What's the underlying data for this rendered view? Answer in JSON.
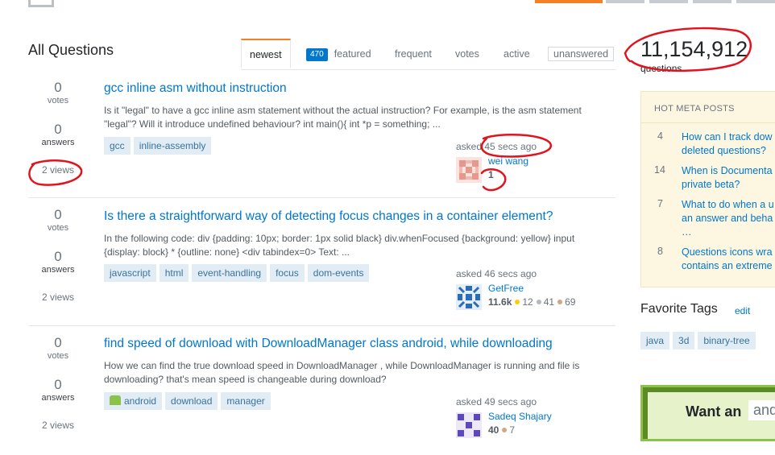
{
  "header": {
    "title": "All Questions"
  },
  "tabs": [
    {
      "label": "newest"
    },
    {
      "label": "featured",
      "badge": "470"
    },
    {
      "label": "frequent"
    },
    {
      "label": "votes"
    },
    {
      "label": "active"
    },
    {
      "label": "unanswered"
    }
  ],
  "questions": [
    {
      "votes": "0",
      "votes_label": "votes",
      "answers": "0",
      "answers_label": "answers",
      "views": "2 views",
      "title": "gcc inline asm without instruction",
      "excerpt": "Is it \"legal\" to have a gcc inline asm statement without the actual instruction? For example, is the asm statement \"legal\"? Will it introduce undefined behaviour? int main(){ int *p = something; ...",
      "tags": [
        "gcc",
        "inline-assembly"
      ],
      "asked": "asked 45 secs ago",
      "user": "wei wang",
      "rep": "1"
    },
    {
      "votes": "0",
      "votes_label": "votes",
      "answers": "0",
      "answers_label": "answers",
      "views": "2 views",
      "title": "Is there a straightforward way of detecting focus changes in a container element?",
      "excerpt": "In the following code: div {padding: 10px; border: 1px solid black} div.whenFocused {background: yellow} input {display: block} * {outline: none} <div tabindex=0> Text: ...",
      "tags": [
        "javascript",
        "html",
        "event-handling",
        "focus",
        "dom-events"
      ],
      "asked": "asked 46 secs ago",
      "user": "GetFree",
      "rep": "11.6k",
      "gold": "12",
      "silver": "41",
      "bronze": "69"
    },
    {
      "votes": "0",
      "votes_label": "votes",
      "answers": "0",
      "answers_label": "answers",
      "views": "2 views",
      "title": "find speed of download with DownloadManager class android, while downloading",
      "excerpt": "How we can find the true download speed in DownloadManager , while DownloadManager is running and file is downloading? that's mean speed is changeable during download?",
      "tags": [
        "android",
        "download",
        "manager"
      ],
      "asked": "asked 49 secs ago",
      "user": "Sadeq Shajary",
      "rep": "40",
      "bronze": "7"
    }
  ],
  "sidebar": {
    "question_count": "11,154,912",
    "question_count_label": "questions",
    "meta_heading": "HOT META POSTS",
    "meta_posts": [
      {
        "num": "4",
        "title": "How can I track dow\ndeleted questions?"
      },
      {
        "num": "14",
        "title": "When is Documenta\nprivate beta?"
      },
      {
        "num": "7",
        "title": "What to do when a u\nan answer and beha\n…"
      },
      {
        "num": "8",
        "title": "Questions icons wra\ncontains an extreme"
      }
    ],
    "favorite_title": "Favorite Tags",
    "favorite_edit": "edit",
    "favorite_tags": [
      "java",
      "3d",
      "binary-tree"
    ],
    "ad_text": "Want an",
    "ad_chip": "andr"
  },
  "colors": {
    "accent": "#f48024",
    "link": "#0077cc",
    "tag_bg": "#e1ecf4",
    "tag_fg": "#39739d",
    "annotation": "#e0141e"
  }
}
